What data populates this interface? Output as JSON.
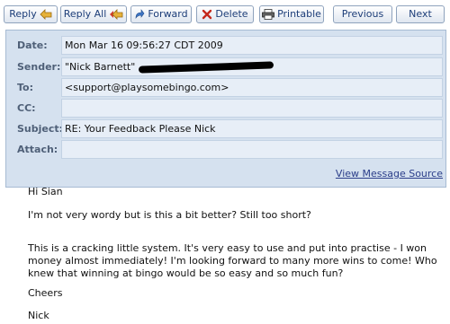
{
  "toolbar": {
    "reply": "Reply",
    "reply_all": "Reply All",
    "forward": "Forward",
    "delete": "Delete",
    "printable": "Printable",
    "previous": "Previous",
    "next": "Next"
  },
  "headers": {
    "date_label": "Date:",
    "date_value": "Mon Mar 16 09:56:27 CDT 2009",
    "sender_label": "Sender:",
    "sender_value": "\"Nick Barnett\"",
    "to_label": "To:",
    "to_value": "<support@playsomebingo.com>",
    "cc_label": "CC:",
    "cc_value": "",
    "subject_label": "Subject:",
    "subject_value": "RE: Your Feedback Please Nick",
    "attach_label": "Attach:",
    "attach_value": ""
  },
  "view_source": "View Message Source",
  "message": {
    "greeting": "Hi Sian",
    "line1": "I'm not very wordy but is this a bit better? Still too short?",
    "para1": "This is a cracking little system. It's very easy to use and put into practise - I won money almost immediately! I'm looking forward to many more wins to come! Who knew that winning at bingo would be so easy and so much fun?",
    "cheers": "Cheers",
    "signature": "Nick"
  },
  "colors": {
    "panel_bg": "#d5e1ef",
    "field_bg": "#e7eef7",
    "label_color": "#4f6078",
    "link_color": "#2b3e8a",
    "button_text": "#1c3d78"
  },
  "icons": [
    "reply-arrow-icon",
    "reply-all-arrow-icon",
    "forward-arrow-icon",
    "delete-x-icon",
    "printer-icon"
  ]
}
